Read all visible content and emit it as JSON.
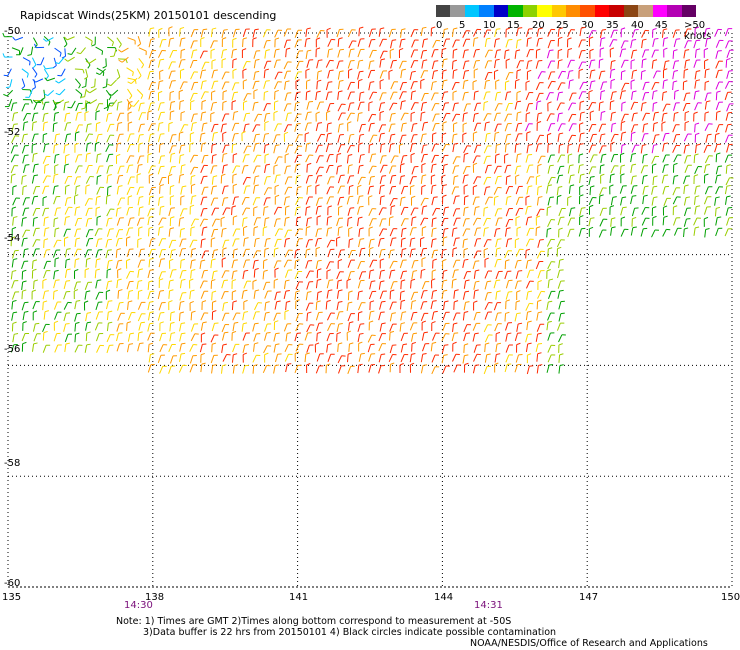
{
  "title": "Rapidscat Winds(25KM) 20150101 descending",
  "legend": {
    "labels": [
      "0",
      "5",
      "10",
      "15",
      "20",
      "25",
      "30",
      "35",
      "40",
      "45",
      ">50 knots"
    ],
    "colors": [
      "#444444",
      "#999999",
      "#00c6ff",
      "#0080ff",
      "#0000c8",
      "#00b400",
      "#8cd200",
      "#ffff00",
      "#ffc800",
      "#ff8c00",
      "#ff5000",
      "#ff0000",
      "#c80000",
      "#8b4513",
      "#c8a07a",
      "#ff00ff",
      "#b400b4",
      "#640064"
    ]
  },
  "axes": {
    "lat_labels": [
      "-50",
      "-52",
      "-54",
      "-56",
      "-58",
      "-60"
    ],
    "lon_labels": [
      "135",
      "138",
      "141",
      "144",
      "147",
      "150"
    ],
    "lat_range": [
      -60,
      -50
    ],
    "lon_range": [
      135,
      150
    ],
    "grid": true
  },
  "time_labels": [
    "14:30",
    "14:31"
  ],
  "notes": {
    "line1": "Note: 1) Times are GMT 2)Times along bottom correspond to measurement at -50S",
    "line2": "3)Data buffer is 22 hrs from 20150101 4) Black circles indicate possible contamination",
    "credit": "NOAA/NESDIS/Office of Research and Applications"
  },
  "wind_field": {
    "description_colors": {
      "light": "#00c6ff",
      "blue": "#0050ff",
      "green": "#00a000",
      "yellowgreen": "#9acd00",
      "yellow": "#ffd800",
      "orange": "#ff9a00",
      "red": "#ff2a00",
      "darkred": "#c80000",
      "magenta": "#dd00dd"
    }
  }
}
